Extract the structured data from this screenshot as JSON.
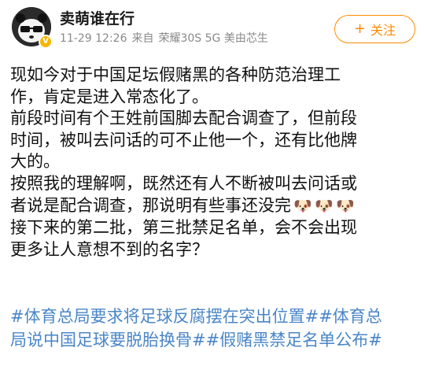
{
  "post": {
    "author": {
      "name": "卖萌谁在行",
      "avatar_icon": "panda-avatar-icon",
      "verified_icon": "verified-badge-icon"
    },
    "meta": {
      "time": "11-29 12:26",
      "source_prefix": "来自",
      "device": "荣耀30S 5G 美由芯生"
    },
    "follow_button": {
      "icon": "plus-icon",
      "plus": "+",
      "label": "关注",
      "color": "#ff8a00"
    },
    "body": {
      "lines": [
        "现如今对于中国足坛假赌黑的各种防范治理工",
        "作，肯定是进入常态化了。",
        "前段时间有个王姓前国脚去配合调查了，但前段",
        "时间，被叫去问话的可不止他一个，还有比他牌",
        "大的。",
        "按照我的理解啊，既然还有人不断被叫去问话或",
        "者说是配合调查，那说明有些事还没完",
        "接下来的第二批，第三批禁足名单，会不会出现",
        "更多让人意想不到的名字？"
      ],
      "emoji": {
        "icon": "doge-emoji-icon",
        "glyph": "🐶",
        "count": 3
      }
    },
    "hashtags": {
      "color": "#4a86c7",
      "items": [
        "#体育总局要求将足球反腐摆在突出位置#",
        "#体育总局说中国足球要脱胎换骨#",
        "#假赌黑禁足名单公布#"
      ]
    }
  }
}
